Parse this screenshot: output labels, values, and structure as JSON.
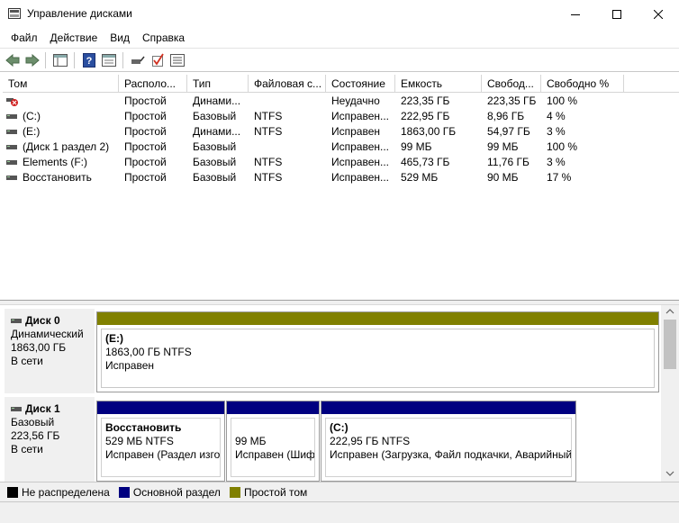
{
  "window": {
    "title": "Управление дисками",
    "minimize_icon": "minimize-icon",
    "maximize_icon": "maximize-icon",
    "close_icon": "close-icon"
  },
  "menu": [
    "Файл",
    "Действие",
    "Вид",
    "Справка"
  ],
  "toolbar": {
    "icons": [
      "back-arrow-icon",
      "forward-arrow-icon",
      "console-tree-icon",
      "help-icon",
      "properties-icon",
      "connect-disk-icon",
      "check-icon",
      "list-view-icon"
    ]
  },
  "volume_table": {
    "columns": [
      "Том",
      "Располо...",
      "Тип",
      "Файловая с...",
      "Состояние",
      "Емкость",
      "Свобод...",
      "Свободно %"
    ],
    "rows": [
      [
        "",
        "Простой",
        "Динами...",
        "",
        "Неудачно",
        "223,35 ГБ",
        "223,35 ГБ",
        "100 %"
      ],
      [
        "(C:)",
        "Простой",
        "Базовый",
        "NTFS",
        "Исправен...",
        "222,95 ГБ",
        "8,96 ГБ",
        "4 %"
      ],
      [
        "(E:)",
        "Простой",
        "Динами...",
        "NTFS",
        "Исправен",
        "1863,00 ГБ",
        "54,97 ГБ",
        "3 %"
      ],
      [
        "(Диск 1 раздел 2)",
        "Простой",
        "Базовый",
        "",
        "Исправен...",
        "99 МБ",
        "99 МБ",
        "100 %"
      ],
      [
        "Elements (F:)",
        "Простой",
        "Базовый",
        "NTFS",
        "Исправен...",
        "465,73 ГБ",
        "11,76 ГБ",
        "3 %"
      ],
      [
        "Восстановить",
        "Простой",
        "Базовый",
        "NTFS",
        "Исправен...",
        "529 МБ",
        "90 МБ",
        "17 %"
      ]
    ]
  },
  "disks": [
    {
      "name": "Диск 0",
      "type": "Динамический",
      "size": "1863,00 ГБ",
      "status": "В сети",
      "partitions": [
        {
          "name": "(E:)",
          "info": "1863,00 ГБ NTFS",
          "status": "Исправен",
          "color": "#808000"
        }
      ]
    },
    {
      "name": "Диск 1",
      "type": "Базовый",
      "size": "223,56 ГБ",
      "status": "В сети",
      "partitions": [
        {
          "name": "Восстановить",
          "info": "529 МБ NTFS",
          "status": "Исправен (Раздел изгот",
          "color": "#000080"
        },
        {
          "name": "",
          "info": "99 МБ",
          "status": "Исправен (Шиф",
          "color": "#000080"
        },
        {
          "name": "(C:)",
          "info": "222,95 ГБ NTFS",
          "status": "Исправен (Загрузка, Файл подкачки, Аварийный",
          "color": "#000080"
        }
      ]
    }
  ],
  "legend": [
    {
      "label": "Не распределена",
      "color": "#000000"
    },
    {
      "label": "Основной раздел",
      "color": "#000080"
    },
    {
      "label": "Простой том",
      "color": "#808000"
    }
  ]
}
